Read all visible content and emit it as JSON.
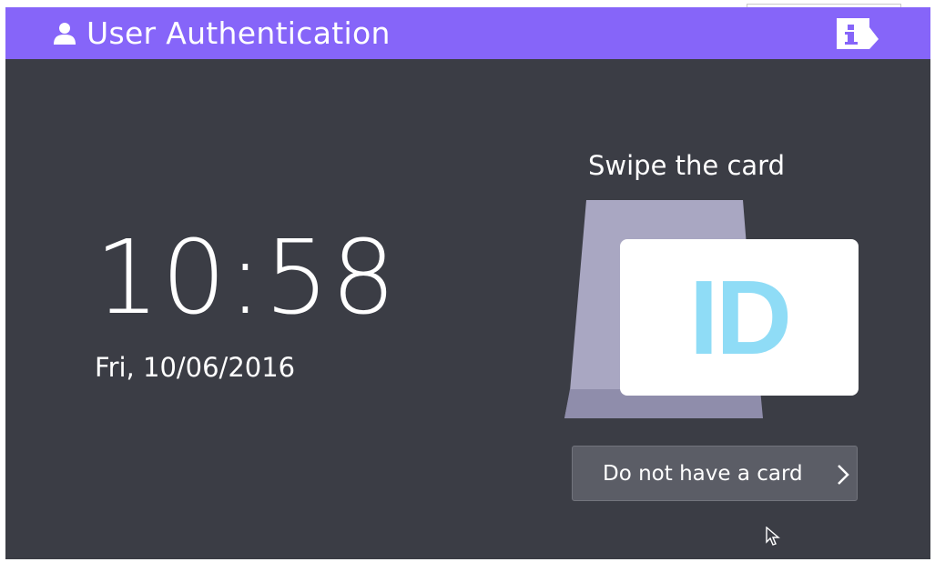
{
  "header": {
    "title": "User Authentication",
    "user_icon": "user-icon",
    "info_icon": "info-icon",
    "background_color": "#8665f9"
  },
  "clock": {
    "time": "10:58",
    "date": "Fri, 10/06/2016"
  },
  "card_panel": {
    "instruction": "Swipe the card",
    "card_text": "ID",
    "card_text_color": "#8fdcf6"
  },
  "actions": {
    "no_card_label": "Do not have a card",
    "no_card_icon": "chevron-right-icon"
  },
  "colors": {
    "screen_background": "#3b3d45",
    "button_background": "#5b5d66"
  }
}
